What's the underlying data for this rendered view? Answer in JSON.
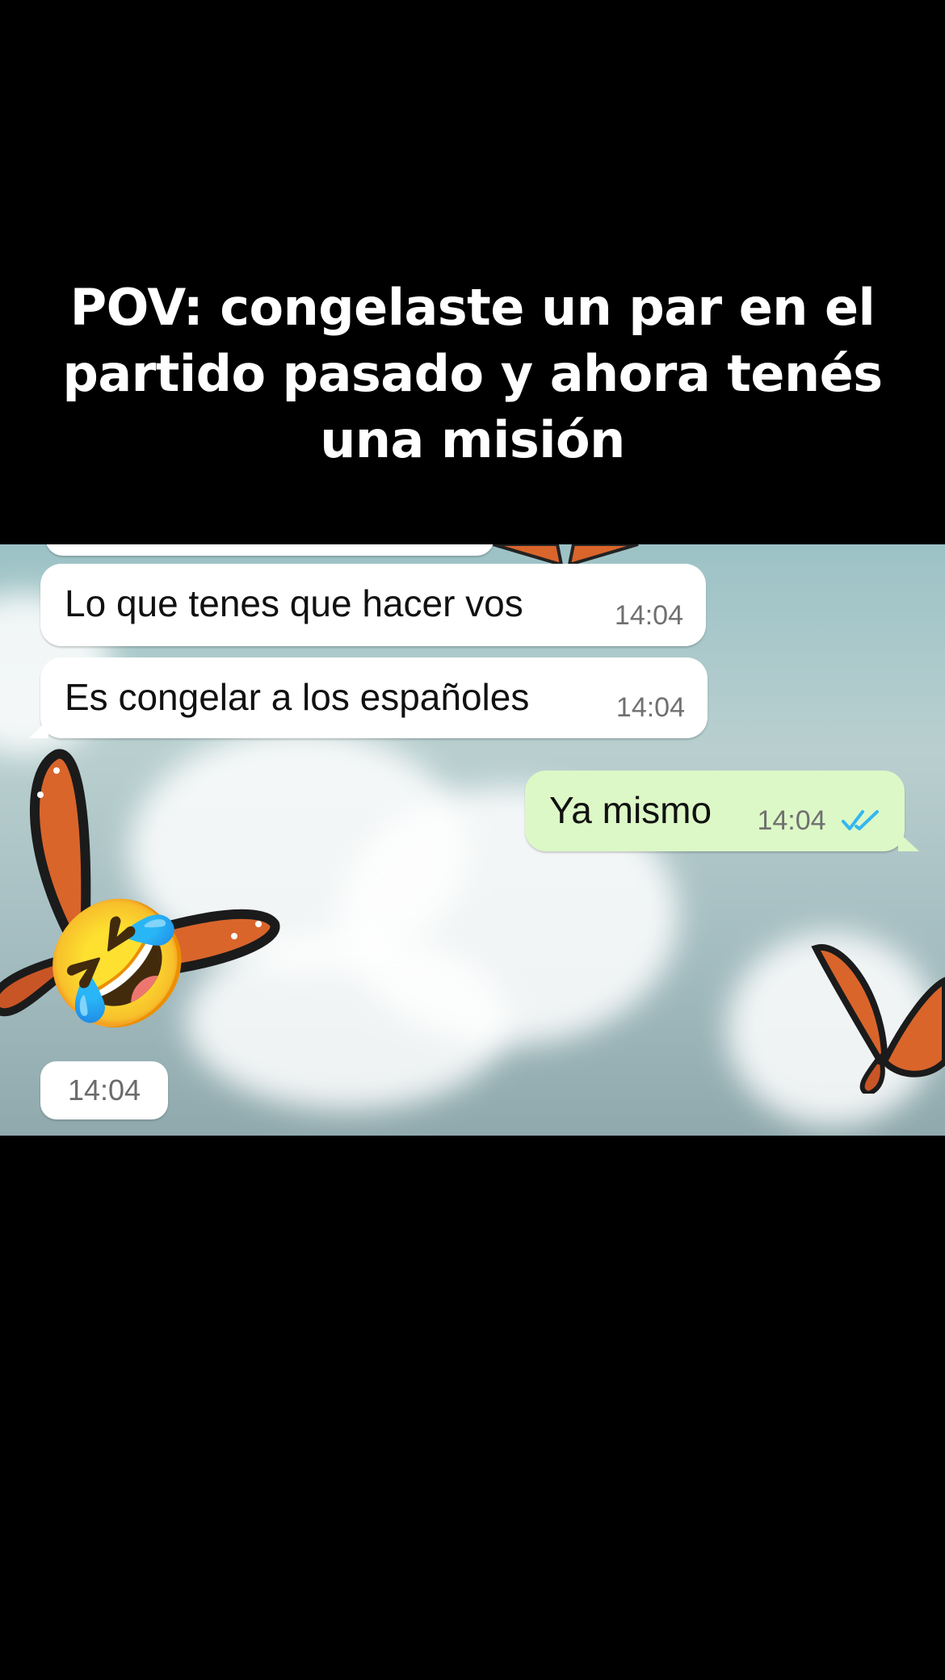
{
  "caption": {
    "line1": "POV: congelaste un par en el",
    "line2": "partido pasado y ahora tenés",
    "line3": "una misión"
  },
  "messages": [
    {
      "direction": "incoming",
      "text": "Lo que tenes que hacer vos",
      "time": "14:04"
    },
    {
      "direction": "incoming",
      "text": "Es congelar a los españoles",
      "time": "14:04"
    },
    {
      "direction": "outgoing",
      "text": "Ya mismo",
      "time": "14:04",
      "status": "read"
    },
    {
      "direction": "incoming",
      "emoji": "🤣",
      "time": "14:04"
    }
  ],
  "colors": {
    "incoming_bubble": "#ffffff",
    "outgoing_bubble": "#dcf8c6",
    "read_ticks": "#34b7f1",
    "butterfly": "#d9652b"
  },
  "icons": [
    "double-check-icon",
    "butterfly-decoration"
  ]
}
